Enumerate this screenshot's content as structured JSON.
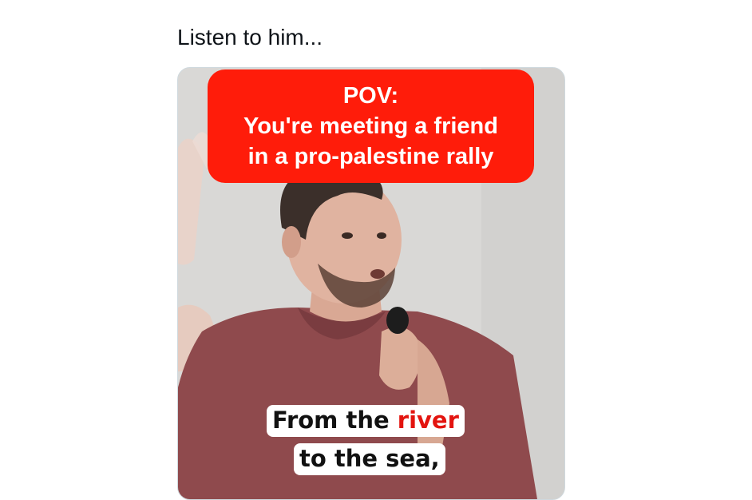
{
  "post": {
    "text": "Listen to him..."
  },
  "media": {
    "caption_top": {
      "line1": "POV:",
      "line2": "You're meeting a friend",
      "line3": "in a pro-palestine rally"
    },
    "caption_bottom": {
      "line1_part1": "From the ",
      "line1_highlight": "river",
      "line2": "to the sea,"
    },
    "colors": {
      "caption_bg": "#ff1c0a",
      "highlight": "#e3140f",
      "shirt": "#8f4a4d"
    }
  }
}
